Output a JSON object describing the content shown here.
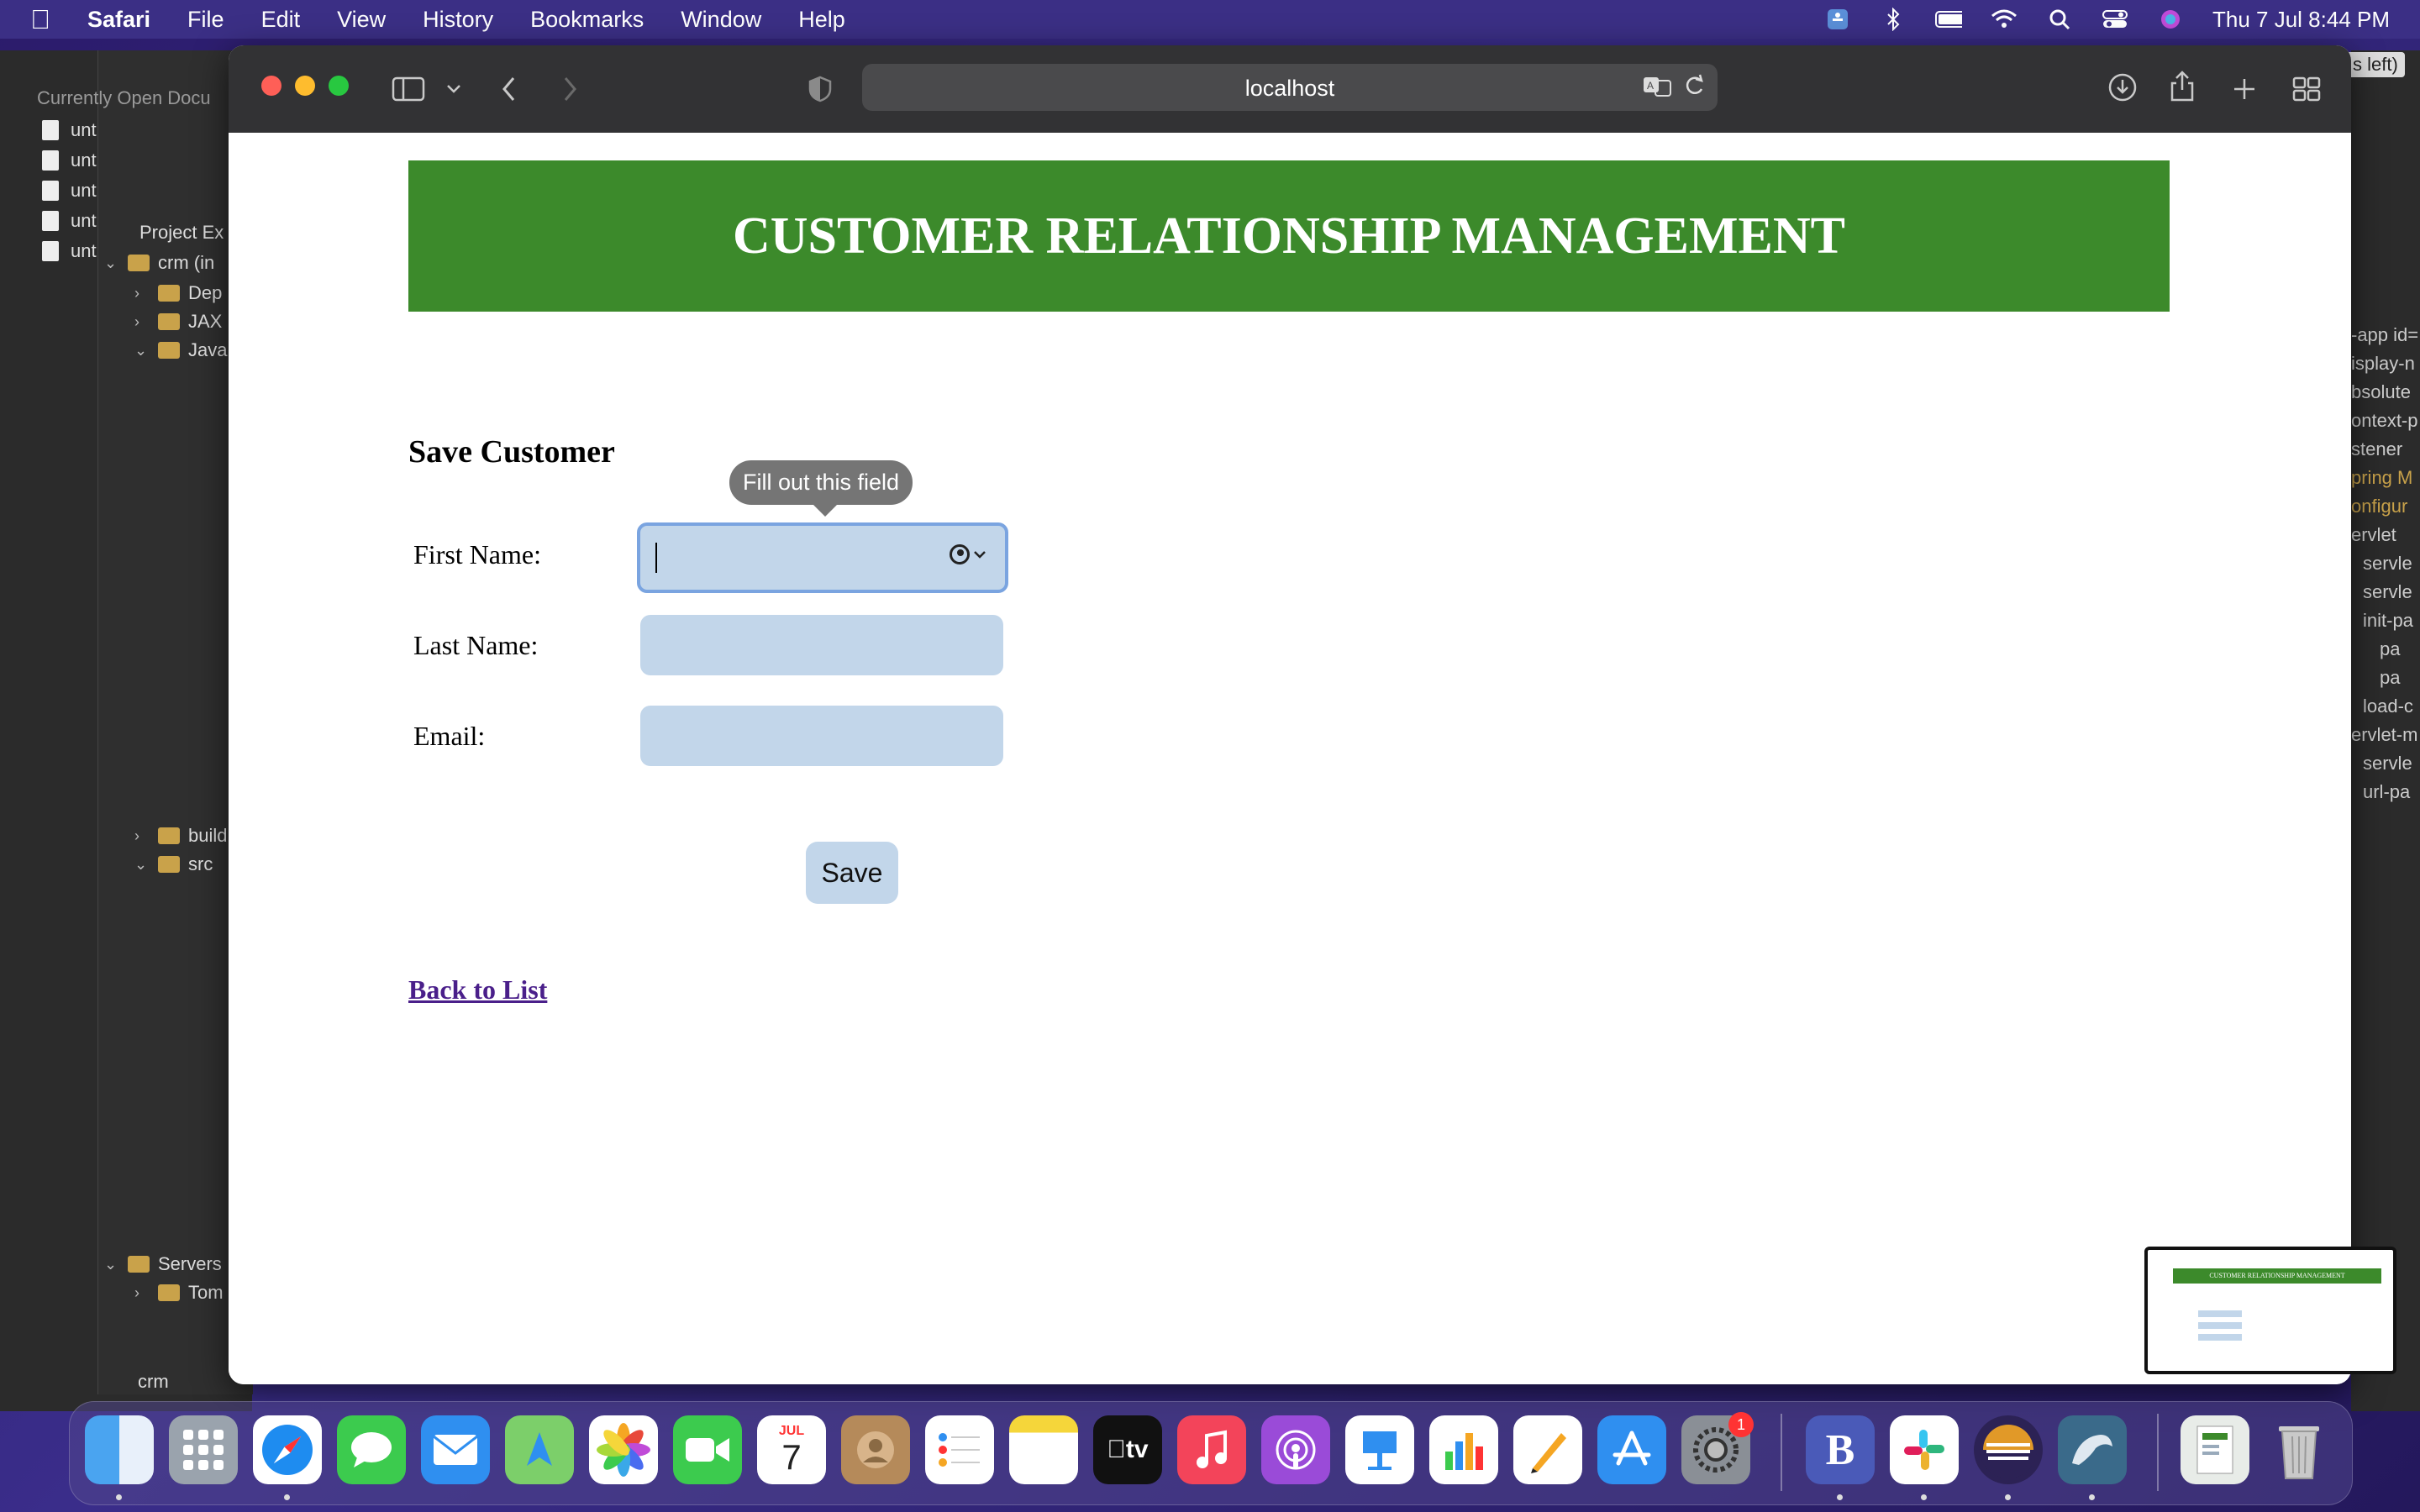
{
  "menubar": {
    "app_name": "Safari",
    "menus": [
      "File",
      "Edit",
      "View",
      "History",
      "Bookmarks",
      "Window",
      "Help"
    ],
    "clock": "Thu 7 Jul  8:44 PM"
  },
  "background_ide": {
    "open_docs_title": "Currently Open Docu",
    "docs": [
      "unt",
      "unt",
      "unt",
      "unt",
      "unt"
    ],
    "project_explorer_title": "Project Ex",
    "tree": [
      "crm (in",
      "Dep",
      "JAX",
      "Java",
      "build",
      "src",
      "Servers",
      "Tom"
    ],
    "bottom_label": "crm",
    "right_panel_lines": [
      "-app id=",
      "isplay-n",
      "bsolute",
      "ontext-p",
      "stener",
      "pring M",
      "onfigur",
      "ervlet",
      "servle",
      "servle",
      "init-pa",
      "pa",
      "pa",
      "load-c",
      "ervlet-m",
      "servle",
      "url-pa"
    ],
    "time_left": "s left)"
  },
  "browser": {
    "url": "localhost"
  },
  "page": {
    "header": "CUSTOMER RELATIONSHIP MANAGEMENT",
    "subtitle": "Save Customer",
    "fields": {
      "first_name_label": "First Name:",
      "first_name_value": "",
      "last_name_label": "Last Name:",
      "last_name_value": "",
      "email_label": "Email:",
      "email_value": ""
    },
    "validation_tooltip": "Fill out this field",
    "save_label": "Save",
    "back_link": "Back to List"
  },
  "thumbnail": {
    "header": "CUSTOMER RELATIONSHIP MANAGEMENT"
  },
  "dock": {
    "items": [
      "Finder",
      "Launchpad",
      "Safari",
      "Messages",
      "Mail",
      "Maps",
      "Photos",
      "FaceTime",
      "Calendar",
      "Contacts",
      "Reminders",
      "Notes",
      "TV",
      "Music",
      "Podcasts",
      "Keynote",
      "Numbers",
      "Pages",
      "App Store",
      "System Preferences",
      "BBEdit",
      "Slack",
      "Eclipse",
      "MySQL Workbench",
      "Preview",
      "Trash"
    ],
    "calendar_month": "JUL",
    "calendar_day": "7",
    "tv_label": "tv",
    "prefs_badge": "1"
  },
  "colors": {
    "header_green": "#3c8a2b",
    "field_blue": "#c2d6ea",
    "focus_ring": "#7aa4e0",
    "link_purple": "#4a1f8a"
  }
}
